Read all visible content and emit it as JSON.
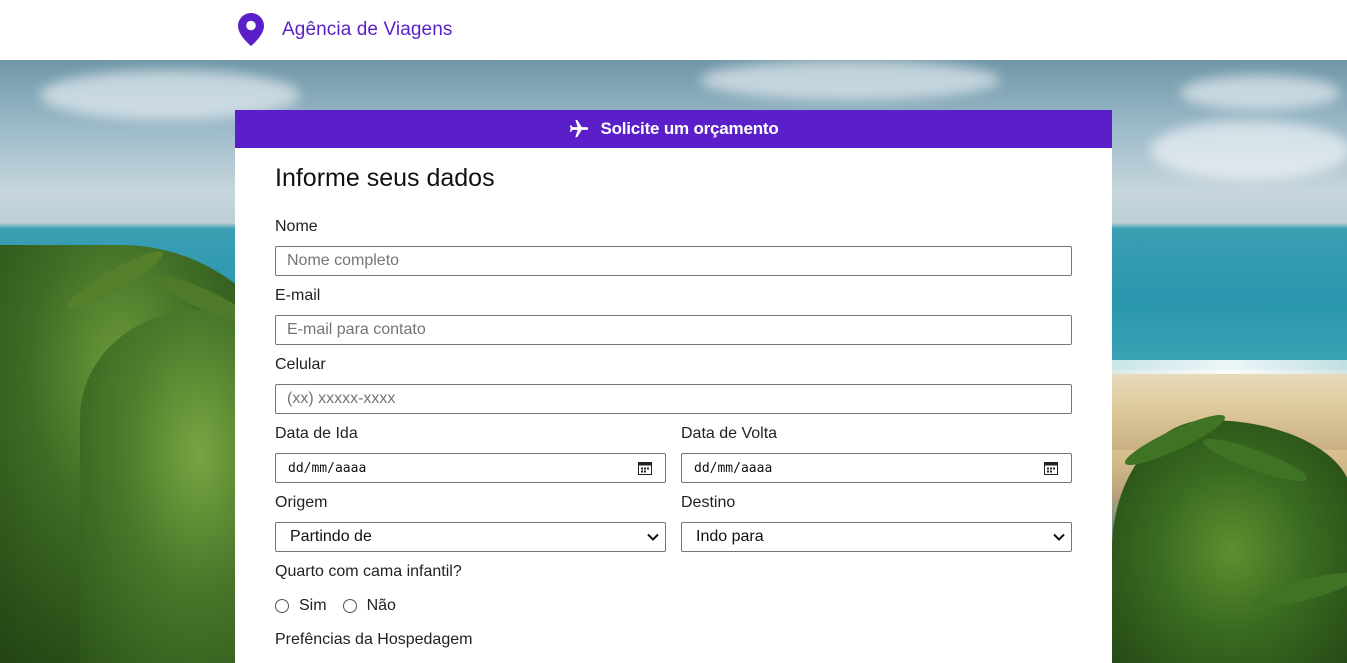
{
  "brand": {
    "name": "Agência de Viagens",
    "icon": "map-pin-icon",
    "color": "#5a1fc9"
  },
  "hero": {
    "description_icon": "beach-background"
  },
  "card": {
    "header_title": "Solicite um orçamento",
    "header_icon": "airplane-icon",
    "header_color": "#5a1fc9"
  },
  "form": {
    "title": "Informe seus dados",
    "nome": {
      "label": "Nome",
      "placeholder": "Nome completo"
    },
    "email": {
      "label": "E-mail",
      "placeholder": "E-mail para contato"
    },
    "celular": {
      "label": "Celular",
      "placeholder": "(xx) xxxxx-xxxx"
    },
    "data_ida": {
      "label": "Data de Ida",
      "value": "dd/mm/aaaa"
    },
    "data_volta": {
      "label": "Data de Volta",
      "value": "dd/mm/aaaa"
    },
    "origem": {
      "label": "Origem",
      "selected": "Partindo de"
    },
    "destino": {
      "label": "Destino",
      "selected": "Indo para"
    },
    "cama_infantil": {
      "label": "Quarto com cama infantil?",
      "options": [
        "Sim",
        "Não"
      ]
    },
    "preferencias": {
      "label": "Prefências da Hospedagem"
    }
  }
}
